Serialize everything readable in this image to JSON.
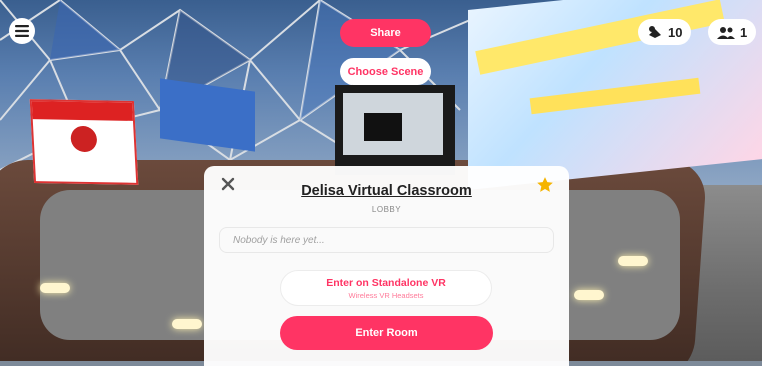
{
  "hud": {
    "share_label": "Share",
    "choose_scene_label": "Choose Scene",
    "object_count": "10",
    "people_count": "1"
  },
  "lobby": {
    "title": "Delisa Virtual Classroom",
    "subtitle": "LOBBY",
    "presence_text": "Nobody is here yet...",
    "vr_button_label": "Enter on Standalone VR",
    "vr_button_sublabel": "Wireless VR Headsets",
    "enter_button_label": "Enter Room"
  },
  "colors": {
    "accent": "#ff3464",
    "star": "#f5b400"
  },
  "icons": {
    "menu": "hamburger-menu-icon",
    "objects": "objects-icon",
    "people": "people-icon",
    "close": "close-icon",
    "favorite": "star-icon"
  }
}
